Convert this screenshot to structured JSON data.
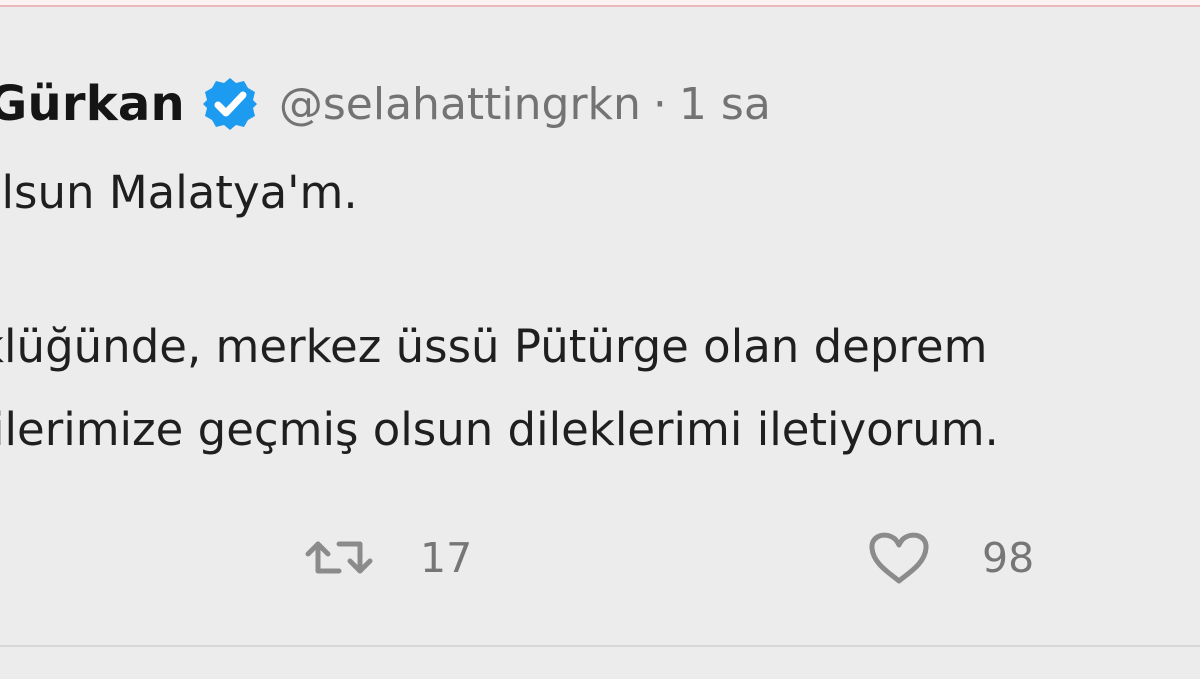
{
  "tweet": {
    "author_name": "in Gürkan",
    "handle": "@selahattingrkn",
    "separator": "·",
    "timestamp": "1 sa",
    "text_lines": [
      "olsun Malatya'm.",
      "klüğünde, merkez üssü Pütürge olan deprem",
      "ilerimize geçmiş olsun dileklerimi iletiyorum."
    ],
    "actions": {
      "retweet_count": "17",
      "like_count": "98"
    }
  },
  "icons": {
    "verified": "verified-badge-icon",
    "retweet": "retweet-icon",
    "like": "heart-icon"
  },
  "colors": {
    "verified": "#1d9bf0",
    "icon_gray": "#8b8b8b",
    "text": "#1f1f1f",
    "muted_text": "#737373",
    "background": "#ececec"
  }
}
